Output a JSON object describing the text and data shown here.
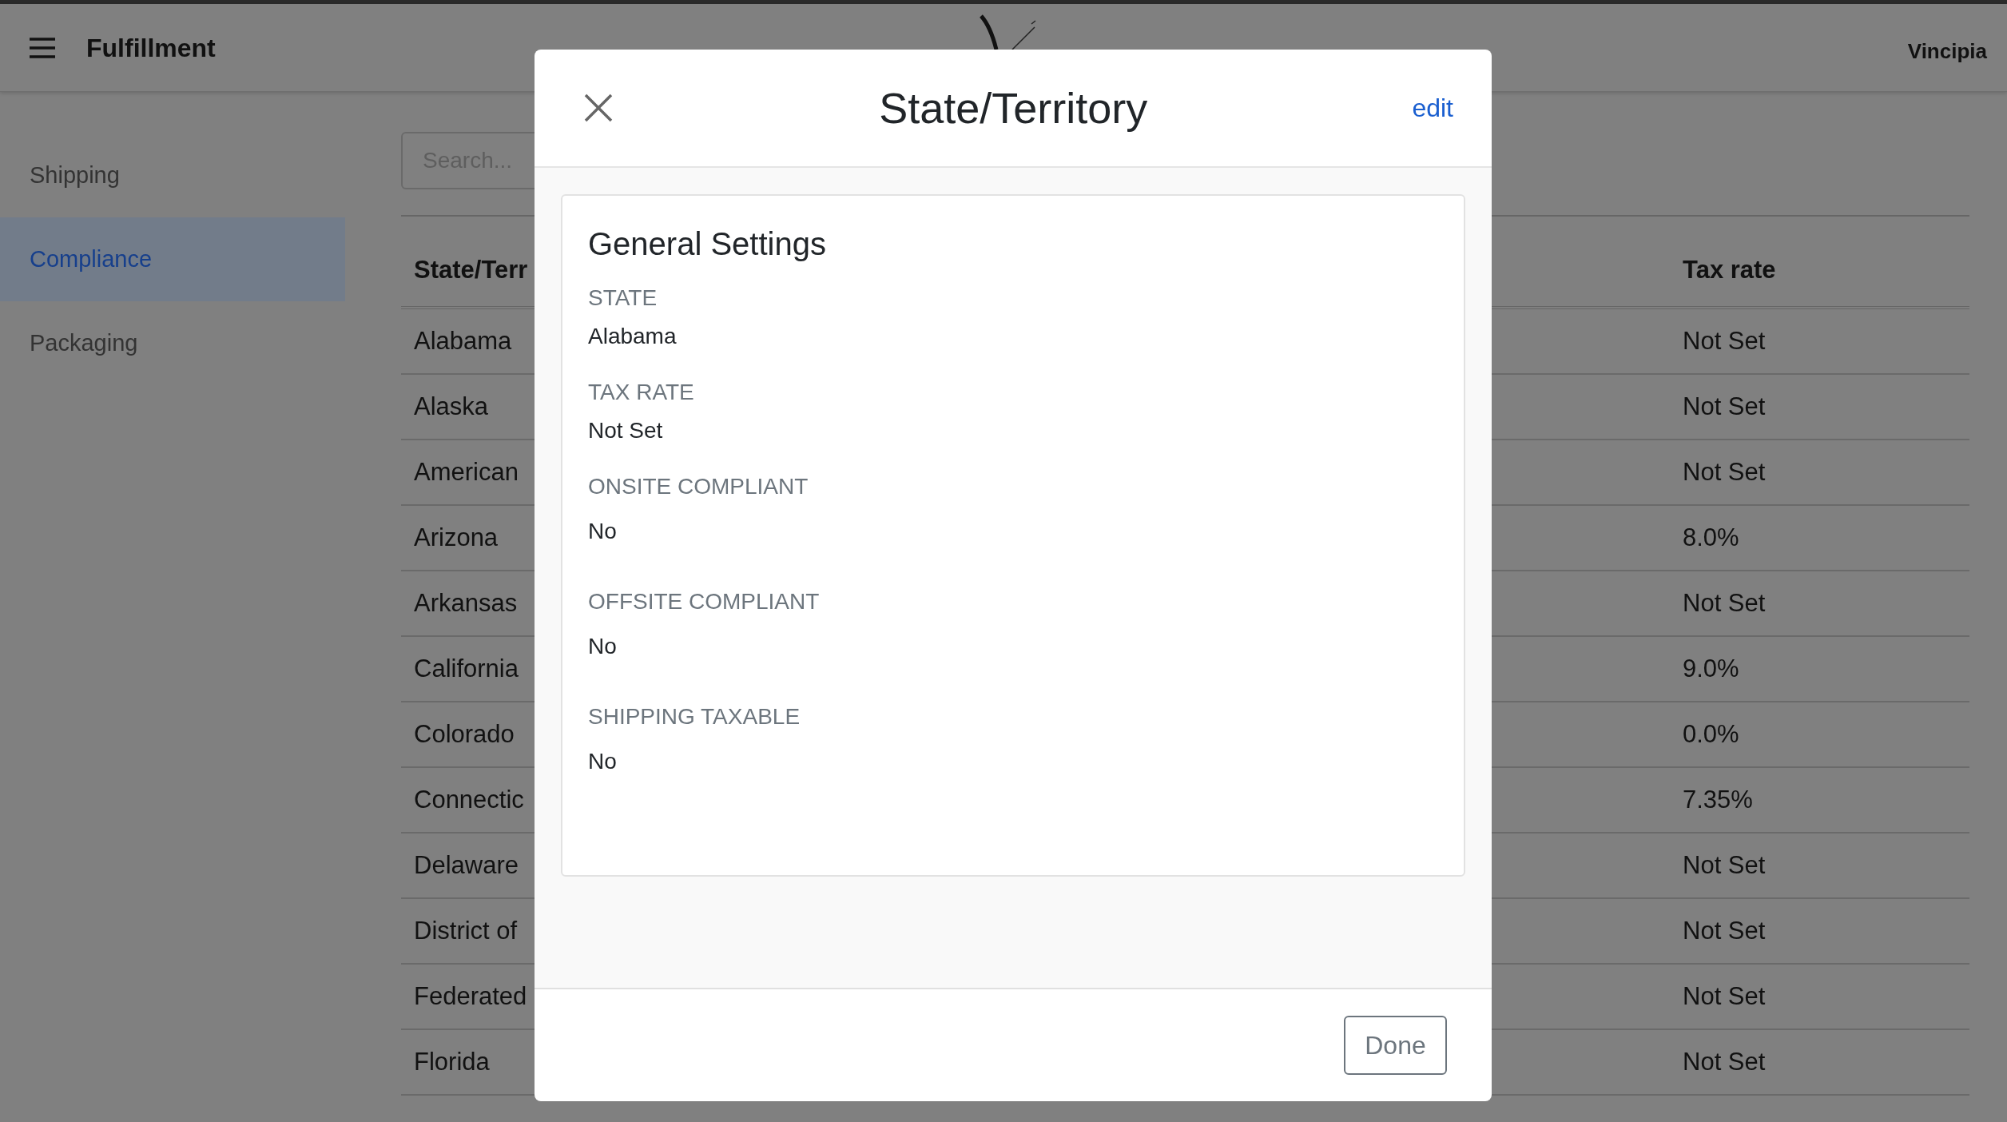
{
  "header": {
    "title": "Fulfillment",
    "account": "Vincipia"
  },
  "sidebar": {
    "items": [
      {
        "label": "Shipping",
        "selected": false
      },
      {
        "label": "Compliance",
        "selected": true
      },
      {
        "label": "Packaging",
        "selected": false
      }
    ]
  },
  "search": {
    "placeholder": "Search..."
  },
  "table": {
    "columns": [
      "State/Terr",
      "Tax rate"
    ],
    "rows": [
      [
        "Alabama",
        "Not Set"
      ],
      [
        "Alaska",
        "Not Set"
      ],
      [
        "American",
        "Not Set"
      ],
      [
        "Arizona",
        "8.0%"
      ],
      [
        "Arkansas",
        "Not Set"
      ],
      [
        "California",
        "9.0%"
      ],
      [
        "Colorado",
        "0.0%"
      ],
      [
        "Connectic",
        "7.35%"
      ],
      [
        "Delaware",
        "Not Set"
      ],
      [
        "District of",
        "Not Set"
      ],
      [
        "Federated",
        "Not Set"
      ],
      [
        "Florida",
        "Not Set"
      ]
    ]
  },
  "modal": {
    "title": "State/Territory",
    "edit": "edit",
    "section_title": "General Settings",
    "fields": [
      {
        "label": "STATE",
        "value": "Alabama"
      },
      {
        "label": "TAX RATE",
        "value": "Not Set"
      },
      {
        "label": "ONSITE COMPLIANT",
        "value": "No"
      },
      {
        "label": "OFFSITE COMPLIANT",
        "value": "No"
      },
      {
        "label": "SHIPPING TAXABLE",
        "value": "No"
      }
    ],
    "done": "Done"
  }
}
